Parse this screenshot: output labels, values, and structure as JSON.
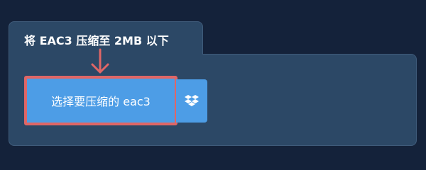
{
  "panel": {
    "title": "将 EAC3 压缩至 2MB 以下"
  },
  "upload": {
    "button_label": "选择要压缩的 eac3",
    "highlight_color": "#e06666",
    "button_color": "#4d9de6"
  },
  "dropbox": {
    "icon": "dropbox-icon"
  },
  "colors": {
    "background": "#14223a",
    "panel": "#2c4866",
    "panel_border": "#3f5b7a"
  }
}
